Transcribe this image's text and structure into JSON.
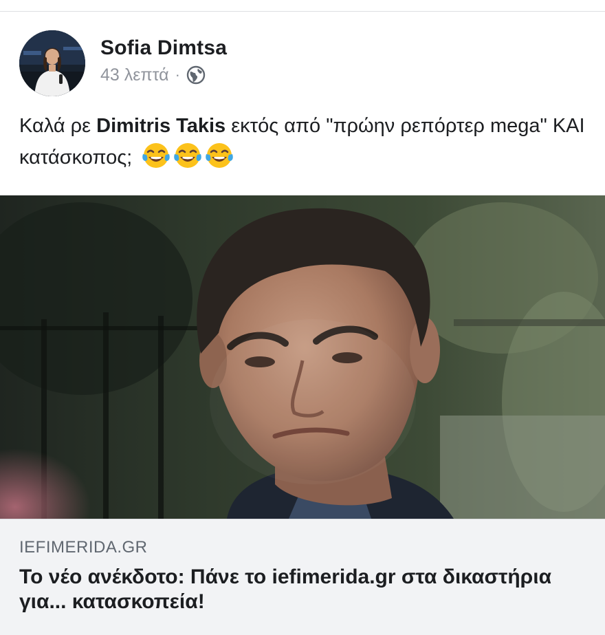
{
  "post": {
    "author": "Sofia Dimtsa",
    "time": "43 λεπτά",
    "separator": "·",
    "privacy_icon": "globe-icon",
    "text_prefix": "Καλά ρε ",
    "mention": "Dimitris Takis",
    "text_suffix": " εκτός από \"πρώην ρεπόρτερ mega\" ΚΑΙ κατάσκοπος;",
    "emojis": [
      "face-with-tears-of-joy-icon",
      "face-with-tears-of-joy-icon",
      "face-with-tears-of-joy-icon"
    ]
  },
  "link_preview": {
    "domain": "IEFIMERIDA.GR",
    "title": "Το νέο ανέκδοτο: Πάνε το iefimerida.gr στα δικαστήρια για... κατασκοπεία!"
  },
  "colors": {
    "text": "#1c1e21",
    "meta": "#90949c",
    "caption_bg": "#f2f3f5",
    "domain": "#606770"
  }
}
